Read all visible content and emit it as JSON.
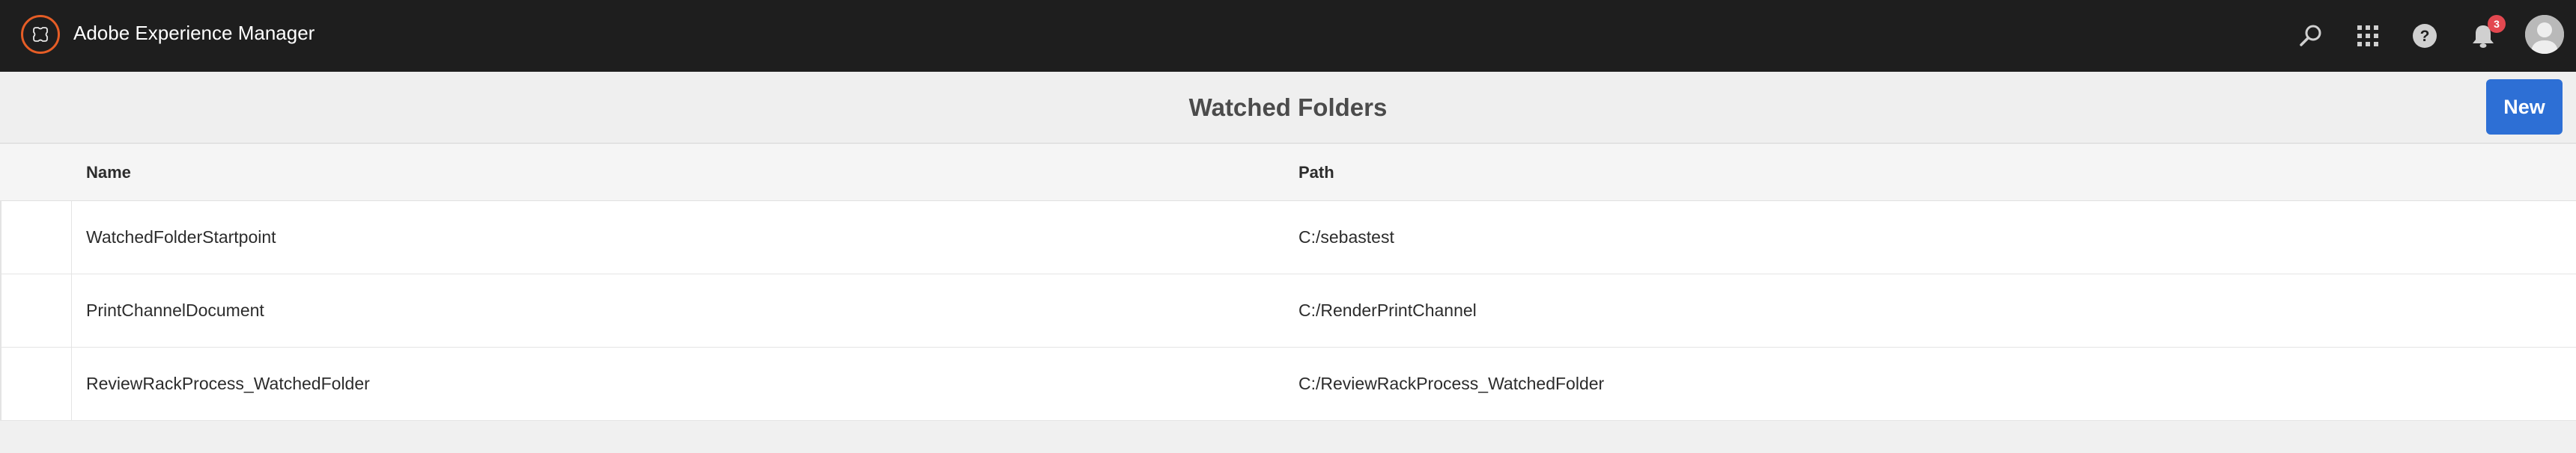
{
  "shell": {
    "app_title": "Adobe Experience Manager",
    "icons": {
      "search": "search-icon",
      "apps": "apps-grid-icon",
      "help": "help-icon",
      "notifications": "bell-icon"
    },
    "notification_count": "3",
    "brand_color": "#e55d26"
  },
  "actionbar": {
    "title": "Watched Folders",
    "new_label": "New",
    "accent": "#2d6fd5"
  },
  "table": {
    "columns": [
      "Name",
      "Path"
    ],
    "rows": [
      {
        "name": "WatchedFolderStartpoint",
        "path": "C:/sebastest"
      },
      {
        "name": "PrintChannelDocument",
        "path": "C:/RenderPrintChannel"
      },
      {
        "name": "ReviewRackProcess_WatchedFolder",
        "path": "C:/ReviewRackProcess_WatchedFolder"
      }
    ]
  }
}
